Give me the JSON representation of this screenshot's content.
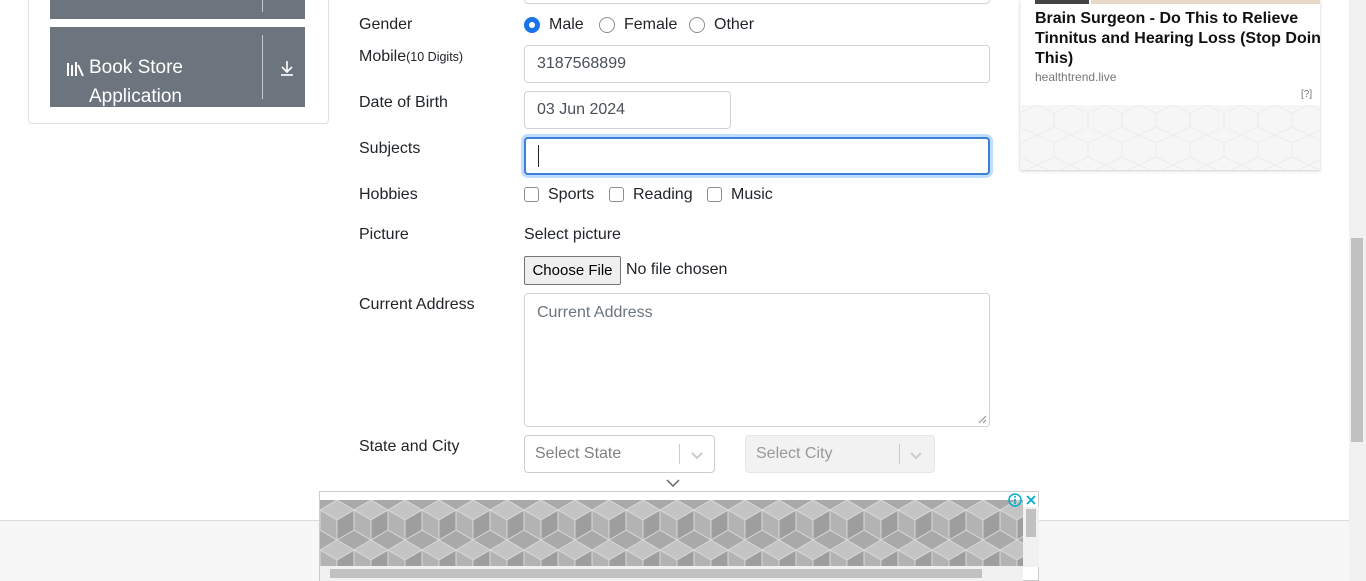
{
  "sidebar": {
    "book_store_label": "Book Store Application"
  },
  "form": {
    "gender_label": "Gender",
    "gender_options": [
      "Male",
      "Female",
      "Other"
    ],
    "gender_selected": "Male",
    "mobile_label": "Mobile",
    "mobile_hint": "(10 Digits)",
    "mobile_value": "3187568899",
    "dob_label": "Date of Birth",
    "dob_value": "03 Jun 2024",
    "subjects_label": "Subjects",
    "subjects_value": "",
    "hobbies_label": "Hobbies",
    "hobbies_options": [
      "Sports",
      "Reading",
      "Music"
    ],
    "picture_label": "Picture",
    "select_picture_label": "Select picture",
    "choose_file_label": "Choose File",
    "no_file_text": "No file chosen",
    "address_label": "Current Address",
    "address_placeholder": "Current Address",
    "state_city_label": "State and City",
    "state_placeholder": "Select State",
    "city_placeholder": "Select City"
  },
  "ad": {
    "title": "Brain Surgeon - Do This to Relieve Tinnitus and Hearing Loss (Stop Doing This)",
    "domain": "healthtrend.live",
    "help": "[?]"
  },
  "colors": {
    "accent": "#1a73e8",
    "sidebar_tile": "#6c757d",
    "focus_border": "#3c7fd6"
  }
}
